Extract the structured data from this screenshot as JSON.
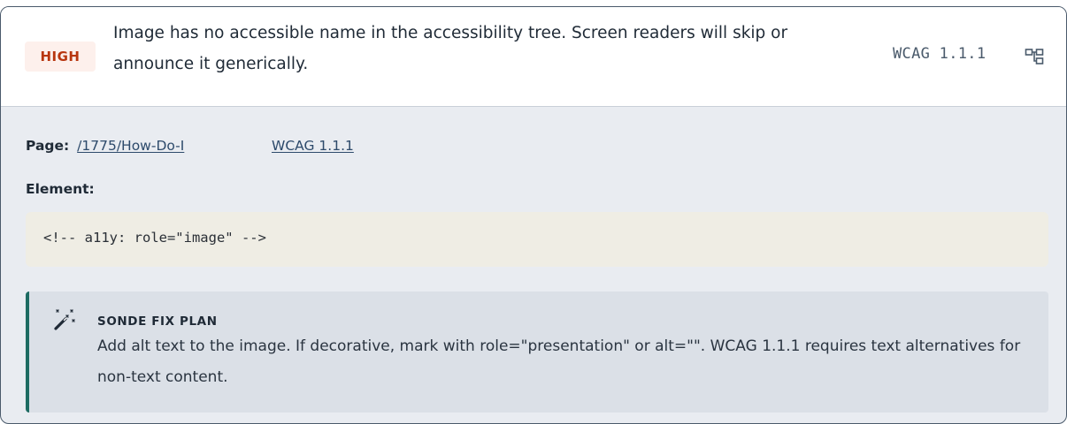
{
  "issue": {
    "severity": "HIGH",
    "description": "Image has no accessible name in the accessibility tree. Screen readers will skip or announce it generically.",
    "wcag_ref": "WCAG 1.1.1",
    "tree_icon": "accessibility-tree-icon"
  },
  "details": {
    "page_label": "Page:",
    "page_link": "/1775/How-Do-I",
    "wcag_link": "WCAG 1.1.1",
    "element_label": "Element:",
    "element_code": "<!-- a11y: role=\"image\" -->"
  },
  "fix_plan": {
    "icon": "magic-wand-icon",
    "title": "SONDE FIX PLAN",
    "text": "Add alt text to the image. If decorative, mark with role=\"presentation\" or alt=\"\". WCAG 1.1.1 requires text alternatives for non-text content."
  },
  "colors": {
    "severity_text": "#b8360f",
    "severity_bg": "#fdf0ec",
    "fix_accent": "#1d6b62",
    "link": "#2d4a6b"
  }
}
